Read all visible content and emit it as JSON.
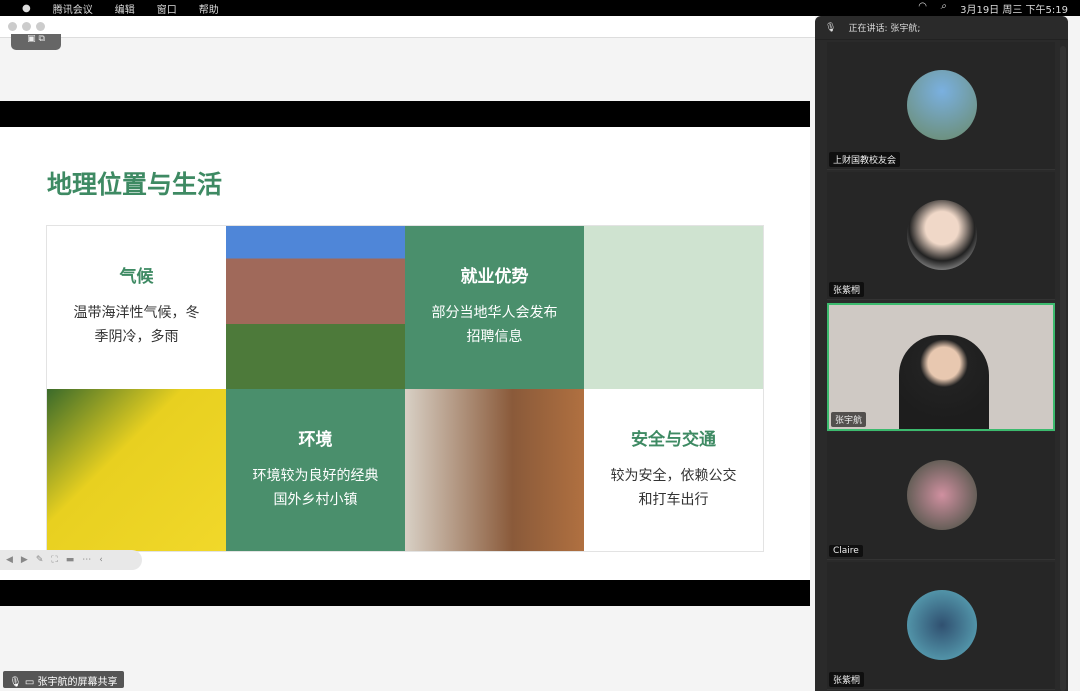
{
  "menubar": {
    "items": [
      "腾讯会议",
      "编辑",
      "窗口",
      "帮助"
    ],
    "clock": "3月19日 周三 下午5:19"
  },
  "slide": {
    "title": "地理位置与生活",
    "cells": [
      {
        "heading": "气候",
        "text": "温带海洋性气候，冬季阴冷，多雨"
      },
      {
        "heading": "就业优势",
        "text": "部分当地华人会发布招聘信息"
      },
      {
        "heading": "环境",
        "text": "环境较为良好的经典国外乡村小镇"
      },
      {
        "heading": "安全与交通",
        "text": "较为安全，依赖公交和打车出行"
      }
    ]
  },
  "share_label": "张宇航的屏幕共享",
  "panel": {
    "speaking": "正在讲话: 张宇航;",
    "participants": [
      {
        "name": "上财国教校友会"
      },
      {
        "name": "张紫桐"
      },
      {
        "name": "张宇航"
      },
      {
        "name": "Claire"
      },
      {
        "name": "张紫桐"
      }
    ]
  },
  "colors": {
    "accent": "#3e8a63",
    "active_border": "#3cba6e"
  }
}
